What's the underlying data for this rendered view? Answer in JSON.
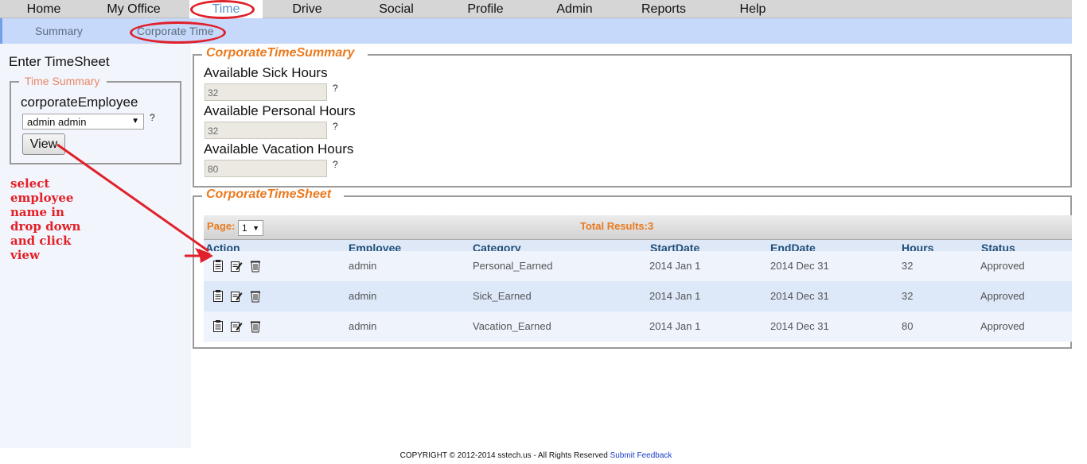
{
  "topnav": {
    "tabs": [
      {
        "label": "Home"
      },
      {
        "label": "My Office"
      },
      {
        "label": "Time"
      },
      {
        "label": "Drive"
      },
      {
        "label": "Social"
      },
      {
        "label": "Profile"
      },
      {
        "label": "Admin"
      },
      {
        "label": "Reports"
      },
      {
        "label": "Help"
      }
    ],
    "active_index": 2
  },
  "subnav": {
    "items": [
      {
        "label": "Summary"
      },
      {
        "label": "Corporate Time"
      }
    ],
    "active_index": 1
  },
  "left_panel": {
    "title": "Enter TimeSheet",
    "time_summary": {
      "legend": "Time Summary",
      "employee_label": "corporateEmployee",
      "employee_select_value": "admin admin",
      "help": "?",
      "view_button": "View"
    },
    "instruction": "select employee name in drop down and click view"
  },
  "summary": {
    "legend": "CorporateTimeSummary",
    "fields": [
      {
        "label": "Available Sick Hours",
        "value": "32",
        "help": "?"
      },
      {
        "label": "Available Personal Hours",
        "value": "32",
        "help": "?"
      },
      {
        "label": "Available Vacation Hours",
        "value": "80",
        "help": "?"
      }
    ]
  },
  "timesheet": {
    "legend": "CorporateTimeSheet",
    "page_label": "Page:",
    "page_value": "1",
    "total_results": "Total Results:3",
    "columns": [
      "Action",
      "Employee",
      "Category",
      "StartDate",
      "EndDate",
      "Hours",
      "Status"
    ],
    "rows": [
      {
        "employee": "admin",
        "category": "Personal_Earned",
        "start": "2014 Jan 1",
        "end": "2014 Dec 31",
        "hours": "32",
        "status": "Approved"
      },
      {
        "employee": "admin",
        "category": "Sick_Earned",
        "start": "2014 Jan 1",
        "end": "2014 Dec 31",
        "hours": "32",
        "status": "Approved"
      },
      {
        "employee": "admin",
        "category": "Vacation_Earned",
        "start": "2014 Jan 1",
        "end": "2014 Dec 31",
        "hours": "80",
        "status": "Approved"
      }
    ],
    "action_icons": [
      "view-icon",
      "edit-icon",
      "delete-icon"
    ]
  },
  "footer": {
    "copyright": "COPYRIGHT © 2012-2014 sstech.us - All Rights Reserved",
    "feedback_link": "Submit Feedback"
  },
  "colors": {
    "annotation_red": "#e0202a",
    "legend_orange": "#ea7a1f",
    "header_blue": "#1f4f7a",
    "subnav_bg": "#c6d9fa"
  }
}
